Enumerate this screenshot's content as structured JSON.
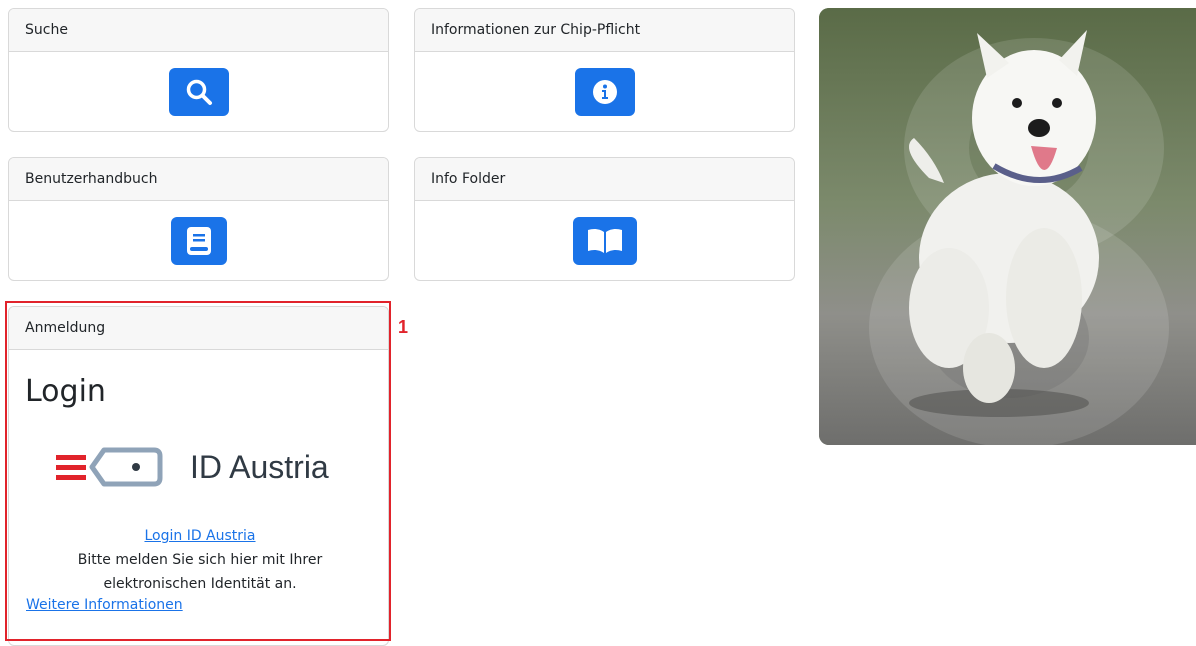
{
  "cards": {
    "search": {
      "title": "Suche"
    },
    "chip_info": {
      "title": "Informationen zur Chip-Pflicht"
    },
    "manual": {
      "title": "Benutzerhandbuch"
    },
    "folder": {
      "title": "Info Folder"
    }
  },
  "login_card": {
    "header": "Anmeldung",
    "title": "Login",
    "logo_text": "ID Austria",
    "link": "Login ID Austria",
    "line1": "Bitte melden Sie sich hier mit Ihrer",
    "line2": "elektronischen Identität an.",
    "more_link": "Weitere Informationen"
  },
  "annotation": {
    "number": "1",
    "color": "#e1232b"
  },
  "colors": {
    "accent": "#1a73e8",
    "header_bg": "#f7f7f7"
  },
  "icons": [
    "search-icon",
    "info-icon",
    "book-icon",
    "open-book-icon"
  ]
}
